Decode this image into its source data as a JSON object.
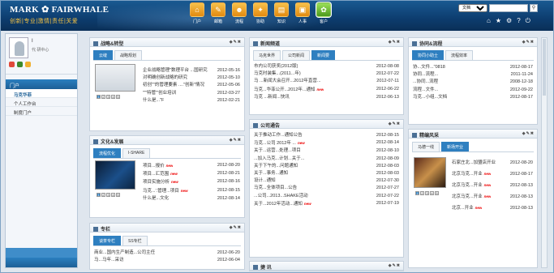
{
  "header": {
    "logo": "MARK ✿ FAIRWHALE",
    "slogan": "创新|专业|激情|责任|关爱"
  },
  "nav": [
    {
      "label": "门户",
      "icon": "home-icon"
    },
    {
      "label": "邮箱",
      "icon": "pen-icon"
    },
    {
      "label": "流程",
      "icon": "person-icon"
    },
    {
      "label": "协助",
      "icon": "tools-icon"
    },
    {
      "label": "知识",
      "icon": "book-icon"
    },
    {
      "label": "人事",
      "icon": "person-card-icon"
    },
    {
      "label": "客户",
      "icon": "customer-icon"
    }
  ],
  "search": {
    "scope": "文档",
    "placeholder": ""
  },
  "user": {
    "name": "I",
    "dept": "代   研中心"
  },
  "sidebar": {
    "head": "门户",
    "items": [
      "马克华菲",
      "个人工作台",
      "制度门户"
    ]
  },
  "panels": {
    "strategy": {
      "title": "战略&转型",
      "tabs": [
        "云缝",
        "战略规划"
      ],
      "rows": [
        {
          "t": "企业战略管理\"数理平台 ...国研究",
          "d": "2012-05-16"
        },
        {
          "t": "对明确创新战略的研究",
          "d": "2012-05-10"
        },
        {
          "t": "初创\"\"的管理要素 ....\"创新\"情况",
          "d": "2012-05-06"
        },
        {
          "t": "\"'''特管\"'创业培训",
          "d": "2012-03-27"
        },
        {
          "t": "什么是...\"F",
          "d": "2012-02-21"
        }
      ]
    },
    "culture": {
      "title": "文化&发展",
      "tabs": [
        "流程优化",
        "I-SHARE"
      ],
      "rows": [
        {
          "t": "项目...报价",
          "d": "2012-08-20",
          "n": true
        },
        {
          "t": "项目...汇范围",
          "d": "2012-08-21",
          "n": true
        },
        {
          "t": "项目实施分析",
          "d": "2012-08-16",
          "n": true
        },
        {
          "t": "马克...'.管理...项目",
          "d": "2012-08-15",
          "n": true
        },
        {
          "t": "什么是...文化",
          "d": "2012-08-14"
        }
      ]
    },
    "column": {
      "title": "专栏",
      "tabs": [
        "谈茶专栏",
        "SS专栏"
      ],
      "rows": [
        {
          "t": "商业...国内生产制造...公司主任",
          "d": "2012-06-20"
        },
        {
          "t": "马...马年...采访",
          "d": "2012-06-04"
        }
      ]
    },
    "news": {
      "title": "新闻频道",
      "tabs": [
        "马克世界",
        "公司新闻",
        "新闻要"
      ],
      "rows": [
        {
          "t": "市内公司获奖(2012版)",
          "d": "2012-08-08"
        },
        {
          "t": "马克时装集...(2011...年)",
          "d": "2012-07-22"
        },
        {
          "t": "马 ...新闻大会召开...2012年直营...",
          "d": "2012-07-11"
        },
        {
          "t": "马克...华菲公开...2012年...通知",
          "d": "2012-06-22",
          "n": true
        },
        {
          "t": "马克 ...新闻...快讯",
          "d": "2012-06-13"
        }
      ]
    },
    "notice": {
      "title": "公司通告",
      "rows": [
        {
          "t": "关于推动工作...通知公告",
          "d": "2012-08-15"
        },
        {
          "t": "马克...公司 2012年 ...",
          "d": "2012-08-14",
          "n": true
        },
        {
          "t": "关于...运营...处理...项目",
          "d": "2012-08-10"
        },
        {
          "t": "...加入马克...计划...关于...",
          "d": "2012-08-09"
        },
        {
          "t": "关于下午的...问题通知",
          "d": "2012-08-03"
        },
        {
          "t": "关于...事务...通知",
          "d": "2012-08-03"
        },
        {
          "t": "设计...通知",
          "d": "2012-07-30"
        },
        {
          "t": "马克...全体项目...公告",
          "d": "2012-07-27"
        },
        {
          "t": "...公司...2013...SHAKE活动",
          "d": "2012-07-22"
        },
        {
          "t": "关于...2012年活动...通知",
          "d": "2012-07-19",
          "n": true
        }
      ]
    },
    "flow": {
      "title": "协同&流程",
      "tabs": [
        "协同小助士",
        "流程效率"
      ],
      "rows": [
        {
          "t": "协...文件...\"0818",
          "d": "2012-08-17"
        },
        {
          "t": "协同...流程...",
          "d": "2011-11-24"
        },
        {
          "t": "...协同...流程",
          "d": "2008-12-18"
        },
        {
          "t": "流程...文件...",
          "d": "2012-09-22"
        },
        {
          "t": "马克...小组...文档",
          "d": "2012-08-17"
        }
      ]
    },
    "style": {
      "title": "精编风采",
      "tabs": [
        "马德一线",
        "新场开业"
      ],
      "rows": [
        {
          "t": "石家庄北...加盟店开业",
          "d": "2012-08-20"
        },
        {
          "t": "北京马克...开业",
          "d": "2012-08-17",
          "n": true
        },
        {
          "t": "北京马克...开业",
          "d": "2012-08-13",
          "n": true
        },
        {
          "t": "北京马克...开业",
          "d": "2012-08-13",
          "n": true
        },
        {
          "t": "北京...开业",
          "d": "2012-08-13",
          "n": true
        }
      ]
    },
    "tail": {
      "title": "捷 讯"
    }
  }
}
